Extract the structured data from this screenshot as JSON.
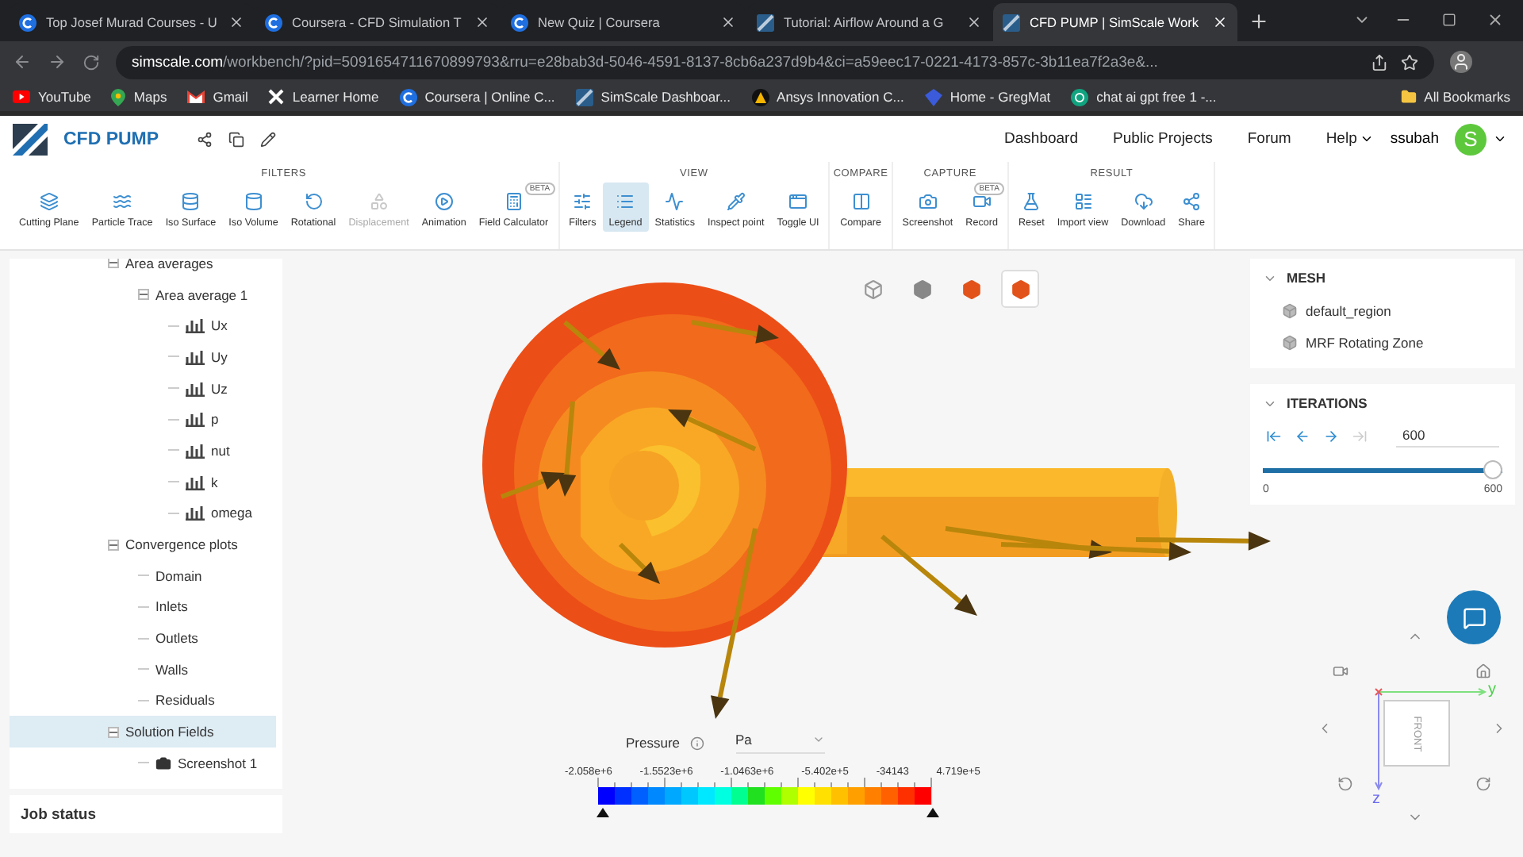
{
  "browser": {
    "tabs": [
      {
        "title": "Top Josef Murad Courses - U",
        "kind": "coursera",
        "selected": false
      },
      {
        "title": "Coursera - CFD Simulation T",
        "kind": "coursera",
        "selected": false
      },
      {
        "title": "New Quiz | Coursera",
        "kind": "coursera",
        "selected": false
      },
      {
        "title": "Tutorial: Airflow Around a G",
        "kind": "simscale",
        "selected": false
      },
      {
        "title": "CFD PUMP | SimScale Work",
        "kind": "simscale",
        "selected": true
      }
    ],
    "url_host": "simscale.com",
    "url_path": "/workbench/?pid=5091654711670899793&rru=e28bab3d-5046-4591-8137-8cb6a237d9b4&ci=a59eec17-0221-4173-857c-3b11ea7f2a3e&...",
    "bookmarks": [
      {
        "label": "YouTube",
        "kind": "play"
      },
      {
        "label": "Maps",
        "kind": "pin"
      },
      {
        "label": "Gmail",
        "kind": "mail"
      },
      {
        "label": "Learner Home",
        "kind": "x"
      },
      {
        "label": "Coursera | Online C...",
        "kind": "coursera"
      },
      {
        "label": "SimScale Dashboar...",
        "kind": "simscale"
      },
      {
        "label": "Ansys Innovation C...",
        "kind": "triangle"
      },
      {
        "label": "Home - GregMat",
        "kind": "shield"
      },
      {
        "label": "chat ai gpt free 1 -...",
        "kind": "knot"
      }
    ],
    "all_bookmarks": "All Bookmarks"
  },
  "app": {
    "title": "CFD PUMP",
    "nav": [
      "Dashboard",
      "Public Projects",
      "Forum",
      "Help"
    ],
    "user": "ssubah",
    "avatar": "S"
  },
  "toolbar": {
    "groups": [
      {
        "label": "FILTERS",
        "buttons": [
          {
            "label": "Cutting Plane",
            "disabled": false,
            "selected": false
          },
          {
            "label": "Particle Trace",
            "disabled": false,
            "selected": false
          },
          {
            "label": "Iso Surface",
            "disabled": false,
            "selected": false
          },
          {
            "label": "Iso Volume",
            "disabled": false,
            "selected": false
          },
          {
            "label": "Rotational",
            "disabled": false,
            "selected": false
          },
          {
            "label": "Displacement",
            "disabled": true,
            "selected": false
          },
          {
            "label": "Animation",
            "disabled": false,
            "selected": false
          },
          {
            "label": "Field Calculator",
            "badge": "BETA",
            "disabled": false,
            "selected": false
          }
        ]
      },
      {
        "label": "VIEW",
        "buttons": [
          {
            "label": "Filters",
            "disabled": false,
            "selected": false
          },
          {
            "label": "Legend",
            "disabled": false,
            "selected": true
          },
          {
            "label": "Statistics",
            "disabled": false,
            "selected": false
          },
          {
            "label": "Inspect point",
            "disabled": false,
            "selected": false
          },
          {
            "label": "Toggle UI",
            "disabled": false,
            "selected": false
          }
        ]
      },
      {
        "label": "COMPARE",
        "buttons": [
          {
            "label": "Compare",
            "disabled": false,
            "selected": false
          }
        ]
      },
      {
        "label": "CAPTURE",
        "buttons": [
          {
            "label": "Screenshot",
            "disabled": false,
            "selected": false
          },
          {
            "label": "Record",
            "badge": "BETA",
            "disabled": false,
            "selected": false
          }
        ]
      },
      {
        "label": "RESULT",
        "buttons": [
          {
            "label": "Reset",
            "disabled": false,
            "selected": false
          },
          {
            "label": "Import view",
            "disabled": false,
            "selected": false
          },
          {
            "label": "Download",
            "disabled": false,
            "selected": false
          },
          {
            "label": "Share",
            "disabled": false,
            "selected": false
          }
        ]
      }
    ]
  },
  "tree": {
    "items": [
      {
        "label": "Area averages",
        "expanded": true,
        "selected": false,
        "children": [
          {
            "label": "Area average 1",
            "expanded": true,
            "selected": false,
            "children": [
              {
                "label": "Ux",
                "kind": "plot",
                "selected": false
              },
              {
                "label": "Uy",
                "kind": "plot",
                "selected": false
              },
              {
                "label": "Uz",
                "kind": "plot",
                "selected": false
              },
              {
                "label": "p",
                "kind": "plot",
                "selected": false
              },
              {
                "label": "nut",
                "kind": "plot",
                "selected": false
              },
              {
                "label": "k",
                "kind": "plot",
                "selected": false
              },
              {
                "label": "omega",
                "kind": "plot",
                "selected": false
              }
            ]
          }
        ]
      },
      {
        "label": "Convergence plots",
        "expanded": true,
        "selected": false,
        "children": [
          {
            "label": "Domain",
            "kind": "plain",
            "selected": false
          },
          {
            "label": "Inlets",
            "kind": "plain",
            "selected": false
          },
          {
            "label": "Outlets",
            "kind": "plain",
            "selected": false
          },
          {
            "label": "Walls",
            "kind": "plain",
            "selected": false
          },
          {
            "label": "Residuals",
            "kind": "plain",
            "selected": false
          }
        ]
      },
      {
        "label": "Solution Fields",
        "expanded": true,
        "selected": true,
        "children": [
          {
            "label": "Screenshot 1",
            "kind": "screenshot",
            "selected": false
          }
        ]
      }
    ]
  },
  "job_status": "Job status",
  "view_modes": [
    {
      "selected": false
    },
    {
      "selected": false
    },
    {
      "selected": false
    },
    {
      "selected": true
    }
  ],
  "mesh": {
    "title": "MESH",
    "expanded": true,
    "items": [
      "default_region",
      "MRF Rotating Zone"
    ]
  },
  "iterations": {
    "title": "ITERATIONS",
    "expanded": true,
    "steps": [
      {
        "kind": "first",
        "disabled": false
      },
      {
        "kind": "prev",
        "disabled": false
      },
      {
        "kind": "next",
        "disabled": false
      },
      {
        "kind": "last",
        "disabled": true
      }
    ],
    "value": "600",
    "level": 1,
    "min": "0",
    "max": "600"
  },
  "legend": {
    "field": "Pressure",
    "unit": "Pa",
    "ticks": [
      "-2.058e+6",
      "-1.5523e+6",
      "-1.0463e+6",
      "-5.402e+5",
      "-34143",
      "4.719e+5"
    ]
  },
  "view_cube": {
    "face": "FRONT",
    "axis_y": "y",
    "axis_z": "z"
  }
}
